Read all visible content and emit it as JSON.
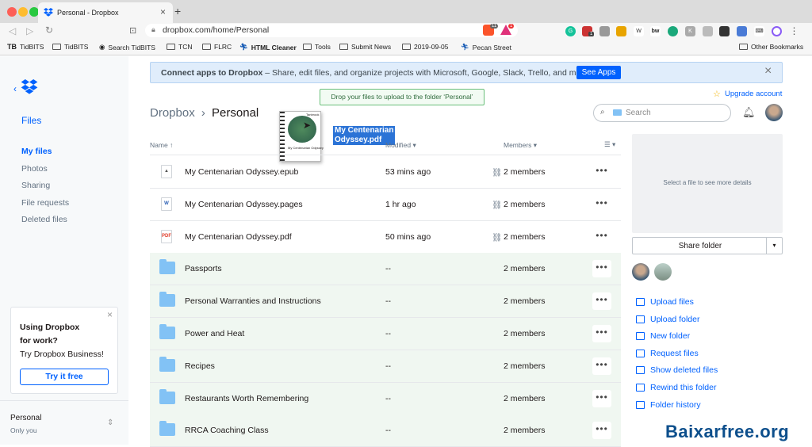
{
  "browser": {
    "tab_title": "Personal - Dropbox",
    "new_tab": "+",
    "url": "dropbox.com/home/Personal",
    "brave_count": "11",
    "alert_count": "1",
    "ext_badge": "1",
    "bookmarks": [
      {
        "label": "TidBITS",
        "icon": "tb-icon"
      },
      {
        "label": "TidBITS",
        "icon": "folder-icon"
      },
      {
        "label": "Search TidBITS",
        "icon": "globe-icon"
      },
      {
        "label": "TCN",
        "icon": "folder-icon"
      },
      {
        "label": "FLRC",
        "icon": "folder-icon"
      },
      {
        "label": "HTML Cleaner",
        "icon": "runner-icon"
      },
      {
        "label": "Tools",
        "icon": "folder-icon"
      },
      {
        "label": "Submit News",
        "icon": "folder-icon"
      },
      {
        "label": "2019-09-05",
        "icon": "folder-icon"
      },
      {
        "label": "Pecan Street",
        "icon": "runner-icon"
      }
    ],
    "other_bookmarks": "Other Bookmarks"
  },
  "sidebar": {
    "back": "‹",
    "section": "Files",
    "items": [
      {
        "label": "My files",
        "active": true
      },
      {
        "label": "Photos",
        "active": false
      },
      {
        "label": "Sharing",
        "active": false
      },
      {
        "label": "File requests",
        "active": false
      },
      {
        "label": "Deleted files",
        "active": false
      }
    ],
    "promo": {
      "title": "Using Dropbox",
      "title2": "for work?",
      "body": "Try Dropbox Business!",
      "button": "Try it free",
      "close": "×"
    },
    "account": {
      "name": "Personal",
      "sub": "Only you",
      "chevron": "⇕"
    }
  },
  "banner": {
    "bold": "Connect apps to Dropbox",
    "text": " – Share, edit files, and organize projects with Microsoft, Google, Slack, Trello, and more.",
    "button": "See Apps",
    "close": "×"
  },
  "upgrade": "Upgrade account",
  "drop_hint": "Drop your files to upload to the folder ‘Personal’",
  "breadcrumb": {
    "root": "Dropbox",
    "sep": "›",
    "current": "Personal"
  },
  "drag": {
    "line1": "My Centenarian",
    "line2": "Odyssey.pdf",
    "thumb_caption": "My Centenarian Odyssey",
    "thumb_title": "Tanbrook"
  },
  "search": {
    "placeholder": "Search"
  },
  "table": {
    "headers": {
      "name": "Name ↑",
      "modified": "Modified ▾",
      "members": "Members ▾",
      "view": "☰ ▾"
    },
    "rows": [
      {
        "type": "epub",
        "name": "My Centenarian Odyssey.epub",
        "modified": "53 mins ago",
        "members": "2 members",
        "shared": true
      },
      {
        "type": "pages",
        "name": "My Centenarian Odyssey.pages",
        "modified": "1 hr ago",
        "members": "2 members",
        "shared": true
      },
      {
        "type": "pdf",
        "name": "My Centenarian Odyssey.pdf",
        "modified": "50 mins ago",
        "members": "2 members",
        "shared": true
      },
      {
        "type": "folder",
        "name": "Passports",
        "modified": "--",
        "members": "2 members",
        "shared": false
      },
      {
        "type": "folder",
        "name": "Personal Warranties and Instructions",
        "modified": "--",
        "members": "2 members",
        "shared": false
      },
      {
        "type": "folder",
        "name": "Power and Heat",
        "modified": "--",
        "members": "2 members",
        "shared": false
      },
      {
        "type": "folder",
        "name": "Recipes",
        "modified": "--",
        "members": "2 members",
        "shared": false
      },
      {
        "type": "folder",
        "name": "Restaurants Worth Remembering",
        "modified": "--",
        "members": "2 members",
        "shared": false
      },
      {
        "type": "folder",
        "name": "RRCA Coaching Class",
        "modified": "--",
        "members": "2 members",
        "shared": false
      }
    ],
    "more": "•••"
  },
  "details": {
    "empty": "Select a file to see more details",
    "share": "Share folder",
    "caret": "▾",
    "actions": [
      {
        "label": "Upload files",
        "icon": "upload-files-icon"
      },
      {
        "label": "Upload folder",
        "icon": "upload-folder-icon"
      },
      {
        "label": "New folder",
        "icon": "new-folder-icon"
      },
      {
        "label": "Request files",
        "icon": "request-files-icon"
      },
      {
        "label": "Show deleted files",
        "icon": "eye-icon"
      },
      {
        "label": "Rewind this folder",
        "icon": "rewind-icon"
      },
      {
        "label": "Folder history",
        "icon": "history-icon"
      }
    ]
  },
  "watermark": "Baixarfree.org",
  "colors": {
    "accent": "#0061fe",
    "drop_green": "#6abf7a",
    "selection": "#2b73d6"
  }
}
